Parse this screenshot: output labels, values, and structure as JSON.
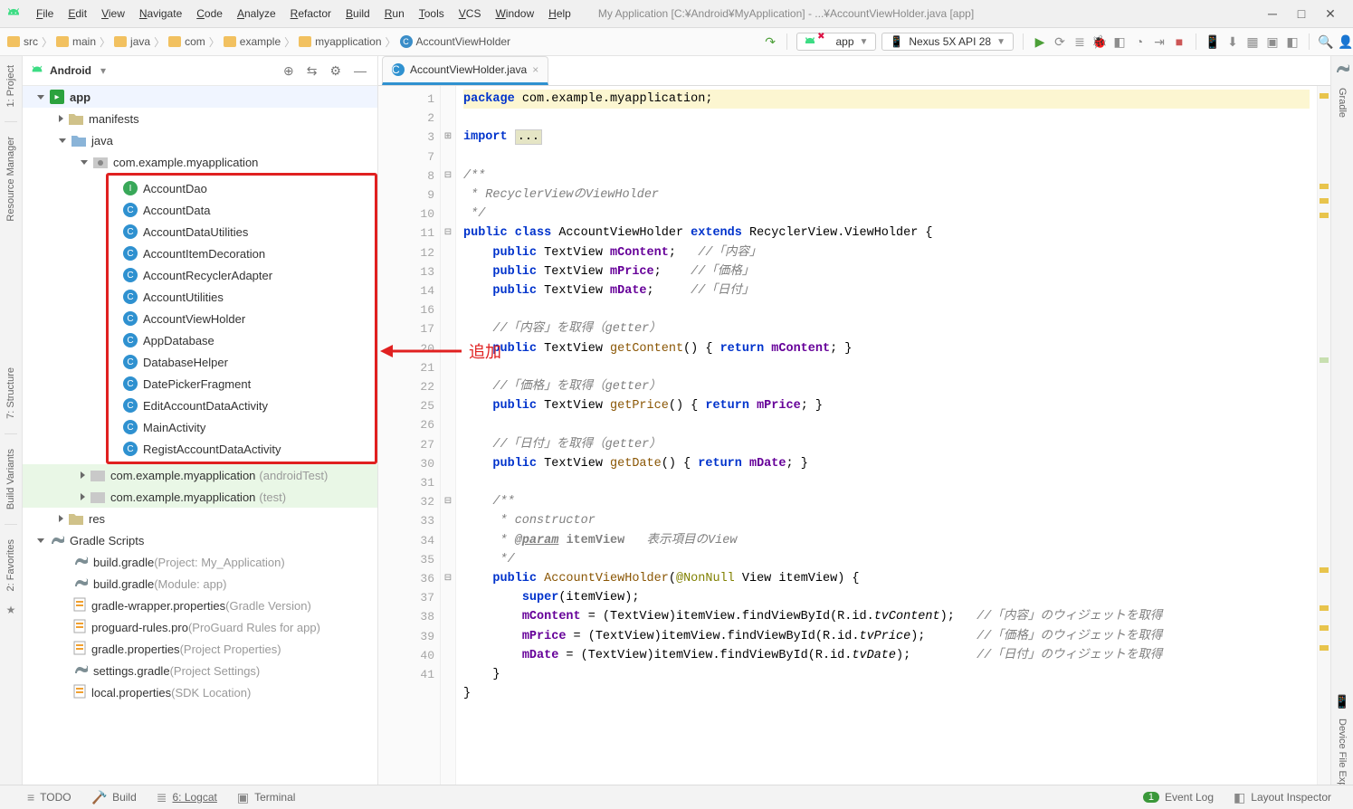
{
  "window": {
    "title": "My Application [C:¥Android¥MyApplication] - ...¥AccountViewHolder.java [app]"
  },
  "menus": [
    "File",
    "Edit",
    "View",
    "Navigate",
    "Code",
    "Analyze",
    "Refactor",
    "Build",
    "Run",
    "Tools",
    "VCS",
    "Window",
    "Help"
  ],
  "breadcrumb": [
    "src",
    "main",
    "java",
    "com",
    "example",
    "myapplication",
    "AccountViewHolder"
  ],
  "run_config": {
    "label": "app"
  },
  "device_sel": {
    "label": "Nexus 5X API 28"
  },
  "project": {
    "scope": "Android",
    "root": {
      "label": "app"
    },
    "manifests_label": "manifests",
    "java_label": "java",
    "pkg_label": "com.example.myapplication",
    "classes": [
      {
        "icon": "I",
        "label": "AccountDao"
      },
      {
        "icon": "C",
        "label": "AccountData"
      },
      {
        "icon": "C",
        "label": "AccountDataUtilities"
      },
      {
        "icon": "C",
        "label": "AccountItemDecoration"
      },
      {
        "icon": "C",
        "label": "AccountRecyclerAdapter"
      },
      {
        "icon": "C",
        "label": "AccountUtilities"
      },
      {
        "icon": "C",
        "label": "AccountViewHolder"
      },
      {
        "icon": "C",
        "label": "AppDatabase"
      },
      {
        "icon": "C",
        "label": "DatabaseHelper"
      },
      {
        "icon": "C",
        "label": "DatePickerFragment"
      },
      {
        "icon": "C",
        "label": "EditAccountDataActivity"
      },
      {
        "icon": "C",
        "label": "MainActivity"
      },
      {
        "icon": "C",
        "label": "RegistAccountDataActivity"
      }
    ],
    "androidTest_label": "com.example.myapplication",
    "androidTest_suffix": "(androidTest)",
    "test_label": "com.example.myapplication",
    "test_suffix": "(test)",
    "res_label": "res",
    "gradle_scripts_label": "Gradle Scripts",
    "gradle_files": [
      {
        "name": "build.gradle",
        "suffix": "(Project: My_Application)"
      },
      {
        "name": "build.gradle",
        "suffix": "(Module: app)"
      },
      {
        "name": "gradle-wrapper.properties",
        "suffix": "(Gradle Version)"
      },
      {
        "name": "proguard-rules.pro",
        "suffix": "(ProGuard Rules for app)"
      },
      {
        "name": "gradle.properties",
        "suffix": "(Project Properties)"
      },
      {
        "name": "settings.gradle",
        "suffix": "(Project Settings)"
      },
      {
        "name": "local.properties",
        "suffix": "(SDK Location)"
      }
    ]
  },
  "annotation": {
    "text": "追加"
  },
  "tabs": [
    {
      "label": "AccountViewHolder.java"
    }
  ],
  "editor": {
    "line_numbers": [
      1,
      2,
      3,
      7,
      8,
      9,
      10,
      11,
      12,
      13,
      14,
      16,
      17,
      20,
      21,
      22,
      25,
      26,
      27,
      30,
      31,
      32,
      33,
      34,
      35,
      36,
      37,
      38,
      39,
      40,
      41
    ],
    "code_tokens": [
      [
        {
          "t": "hl",
          "v": ""
        },
        {
          "t": "kw",
          "v": "package"
        },
        {
          "t": "tx",
          "v": " com.example.myapplication;"
        }
      ],
      [],
      [
        {
          "t": "kw",
          "v": "import "
        },
        {
          "t": "fold",
          "v": "..."
        }
      ],
      [],
      [
        {
          "t": "doc",
          "v": "/**"
        }
      ],
      [
        {
          "t": "doc",
          "v": " * RecyclerViewのViewHolder"
        }
      ],
      [
        {
          "t": "doc",
          "v": " */"
        }
      ],
      [
        {
          "t": "kw",
          "v": "public class"
        },
        {
          "t": "tx",
          "v": " AccountViewHolder "
        },
        {
          "t": "kw",
          "v": "extends"
        },
        {
          "t": "tx",
          "v": " RecyclerView.ViewHolder {"
        }
      ],
      [
        {
          "t": "tx",
          "v": "    "
        },
        {
          "t": "kw",
          "v": "public"
        },
        {
          "t": "tx",
          "v": " TextView "
        },
        {
          "t": "fld",
          "v": "mContent"
        },
        {
          "t": "tx",
          "v": ";   "
        },
        {
          "t": "cm",
          "v": "//「内容」"
        }
      ],
      [
        {
          "t": "tx",
          "v": "    "
        },
        {
          "t": "kw",
          "v": "public"
        },
        {
          "t": "tx",
          "v": " TextView "
        },
        {
          "t": "fld",
          "v": "mPrice"
        },
        {
          "t": "tx",
          "v": ";    "
        },
        {
          "t": "cm",
          "v": "//「価格」"
        }
      ],
      [
        {
          "t": "tx",
          "v": "    "
        },
        {
          "t": "kw",
          "v": "public"
        },
        {
          "t": "tx",
          "v": " TextView "
        },
        {
          "t": "fld",
          "v": "mDate"
        },
        {
          "t": "tx",
          "v": ";     "
        },
        {
          "t": "cm",
          "v": "//「日付」"
        }
      ],
      [],
      [
        {
          "t": "tx",
          "v": "    "
        },
        {
          "t": "cm",
          "v": "//「内容」を取得（getter）"
        }
      ],
      [
        {
          "t": "tx",
          "v": "    "
        },
        {
          "t": "kw",
          "v": "public"
        },
        {
          "t": "tx",
          "v": " TextView "
        },
        {
          "t": "mtd",
          "v": "getContent"
        },
        {
          "t": "tx",
          "v": "() { "
        },
        {
          "t": "kw",
          "v": "return"
        },
        {
          "t": "tx",
          "v": " "
        },
        {
          "t": "fld",
          "v": "mContent"
        },
        {
          "t": "tx",
          "v": "; }"
        }
      ],
      [],
      [
        {
          "t": "tx",
          "v": "    "
        },
        {
          "t": "cm",
          "v": "//「価格」を取得（getter）"
        }
      ],
      [
        {
          "t": "tx",
          "v": "    "
        },
        {
          "t": "kw",
          "v": "public"
        },
        {
          "t": "tx",
          "v": " TextView "
        },
        {
          "t": "mtd",
          "v": "getPrice"
        },
        {
          "t": "tx",
          "v": "() { "
        },
        {
          "t": "kw",
          "v": "return"
        },
        {
          "t": "tx",
          "v": " "
        },
        {
          "t": "fld",
          "v": "mPrice"
        },
        {
          "t": "tx",
          "v": "; }"
        }
      ],
      [],
      [
        {
          "t": "tx",
          "v": "    "
        },
        {
          "t": "cm",
          "v": "//「日付」を取得（getter）"
        }
      ],
      [
        {
          "t": "tx",
          "v": "    "
        },
        {
          "t": "kw",
          "v": "public"
        },
        {
          "t": "tx",
          "v": " TextView "
        },
        {
          "t": "mtd",
          "v": "getDate"
        },
        {
          "t": "tx",
          "v": "() { "
        },
        {
          "t": "kw",
          "v": "return"
        },
        {
          "t": "tx",
          "v": " "
        },
        {
          "t": "fld",
          "v": "mDate"
        },
        {
          "t": "tx",
          "v": "; }"
        }
      ],
      [],
      [
        {
          "t": "doc",
          "v": "    /**"
        }
      ],
      [
        {
          "t": "doc",
          "v": "     * constructor"
        }
      ],
      [
        {
          "t": "doc",
          "v": "     * "
        },
        {
          "t": "docu",
          "v": "@param"
        },
        {
          "t": "doc",
          "v": " "
        },
        {
          "t": "docb",
          "v": "itemView"
        },
        {
          "t": "doc",
          "v": "   表示項目のView"
        }
      ],
      [
        {
          "t": "doc",
          "v": "     */"
        }
      ],
      [
        {
          "t": "tx",
          "v": "    "
        },
        {
          "t": "kw",
          "v": "public"
        },
        {
          "t": "tx",
          "v": " "
        },
        {
          "t": "mtd",
          "v": "AccountViewHolder"
        },
        {
          "t": "tx",
          "v": "("
        },
        {
          "t": "ann",
          "v": "@NonNull"
        },
        {
          "t": "tx",
          "v": " View itemView) {"
        }
      ],
      [
        {
          "t": "tx",
          "v": "        "
        },
        {
          "t": "kw",
          "v": "super"
        },
        {
          "t": "tx",
          "v": "(itemView);"
        }
      ],
      [
        {
          "t": "tx",
          "v": "        "
        },
        {
          "t": "fld",
          "v": "mContent"
        },
        {
          "t": "tx",
          "v": " = (TextView)itemView.findViewById(R.id."
        },
        {
          "t": "decl",
          "v": "tvContent"
        },
        {
          "t": "tx",
          "v": ");   "
        },
        {
          "t": "cm",
          "v": "//「内容」のウィジェットを取得"
        }
      ],
      [
        {
          "t": "tx",
          "v": "        "
        },
        {
          "t": "fld",
          "v": "mPrice"
        },
        {
          "t": "tx",
          "v": " = (TextView)itemView.findViewById(R.id."
        },
        {
          "t": "decl",
          "v": "tvPrice"
        },
        {
          "t": "tx",
          "v": ");       "
        },
        {
          "t": "cm",
          "v": "//「価格」のウィジェットを取得"
        }
      ],
      [
        {
          "t": "tx",
          "v": "        "
        },
        {
          "t": "fld",
          "v": "mDate"
        },
        {
          "t": "tx",
          "v": " = (TextView)itemView.findViewById(R.id."
        },
        {
          "t": "decl",
          "v": "tvDate"
        },
        {
          "t": "tx",
          "v": ");         "
        },
        {
          "t": "cm",
          "v": "//「日付」のウィジェットを取得"
        }
      ],
      [
        {
          "t": "tx",
          "v": "    }"
        }
      ],
      [
        {
          "t": "tx",
          "v": "}"
        }
      ]
    ]
  },
  "left_rail": {
    "project": "1: Project",
    "res_mgr": "Resource Manager",
    "structure": "7: Structure",
    "variants": "Build Variants",
    "favs": "2: Favorites"
  },
  "right_rail": {
    "gradle": "Gradle",
    "dfe": "Device File Explorer"
  },
  "bottom_tools": {
    "todo": "TODO",
    "build": "Build",
    "logcat": "6: Logcat",
    "terminal": "Terminal"
  },
  "statusbar": {
    "event_log": "Event Log",
    "layout_insp": "Layout Inspector",
    "event_count": "1"
  }
}
